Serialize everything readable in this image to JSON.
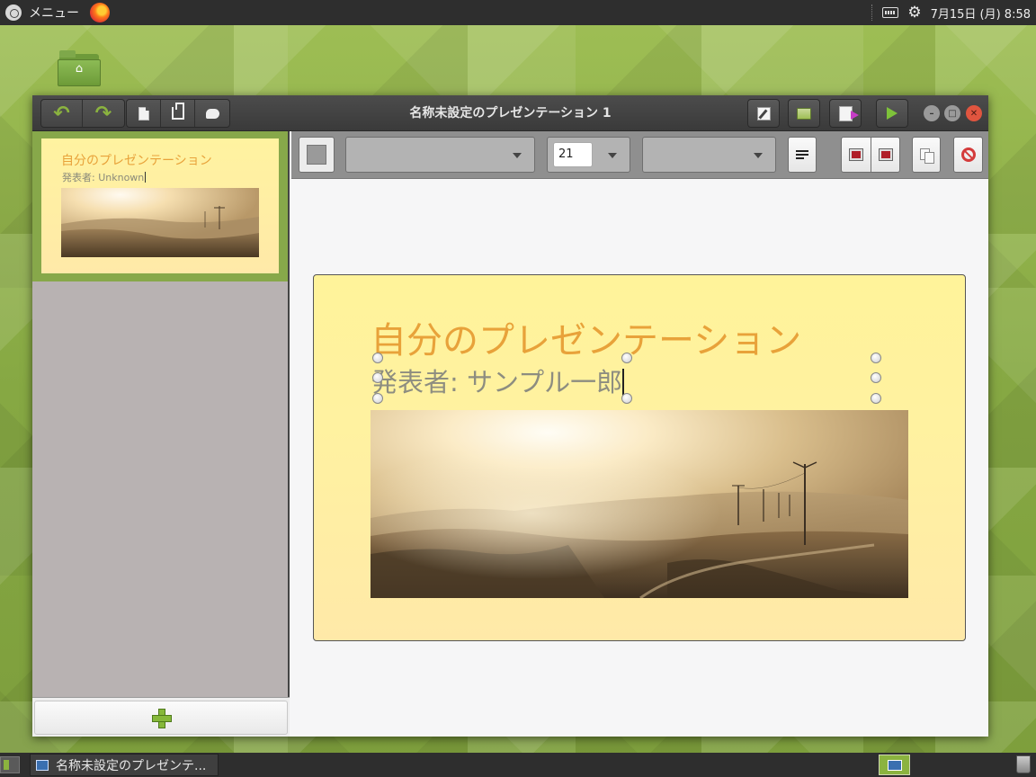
{
  "top_panel": {
    "menu_label": "メニュー",
    "launcher_icon": "firefox-icon",
    "clock": "7月15日 (月) 8:58"
  },
  "desktop": {
    "home_folder_icon": "home-folder-icon"
  },
  "window": {
    "title": "名称未設定のプレゼンテーション 1",
    "toolbar_icons": [
      "undo-icon",
      "redo-icon",
      "new-slide-icon",
      "duplicate-slide-icon",
      "comment-icon",
      "edit-icon",
      "open-icon",
      "export-icon",
      "play-icon"
    ],
    "controls": [
      "minimize",
      "maximize",
      "close"
    ]
  },
  "sidebar": {
    "thumbnail": {
      "title": "自分のプレゼンテーション",
      "subtitle": "発表者: Unknown"
    },
    "add_slide_icon": "plus-icon"
  },
  "edit_toolbar": {
    "font_family_value": "",
    "font_size_value": "21",
    "text_align_value": ""
  },
  "slide": {
    "title": "自分のプレゼンテーション",
    "subtitle": "発表者: サンプル一郎"
  },
  "taskbar": {
    "task_label": "名称未設定のプレゼンテ..."
  },
  "colors": {
    "accent_green": "#8bb33f",
    "slide_title": "#e8a23a",
    "slide_background": "#fff39a"
  }
}
